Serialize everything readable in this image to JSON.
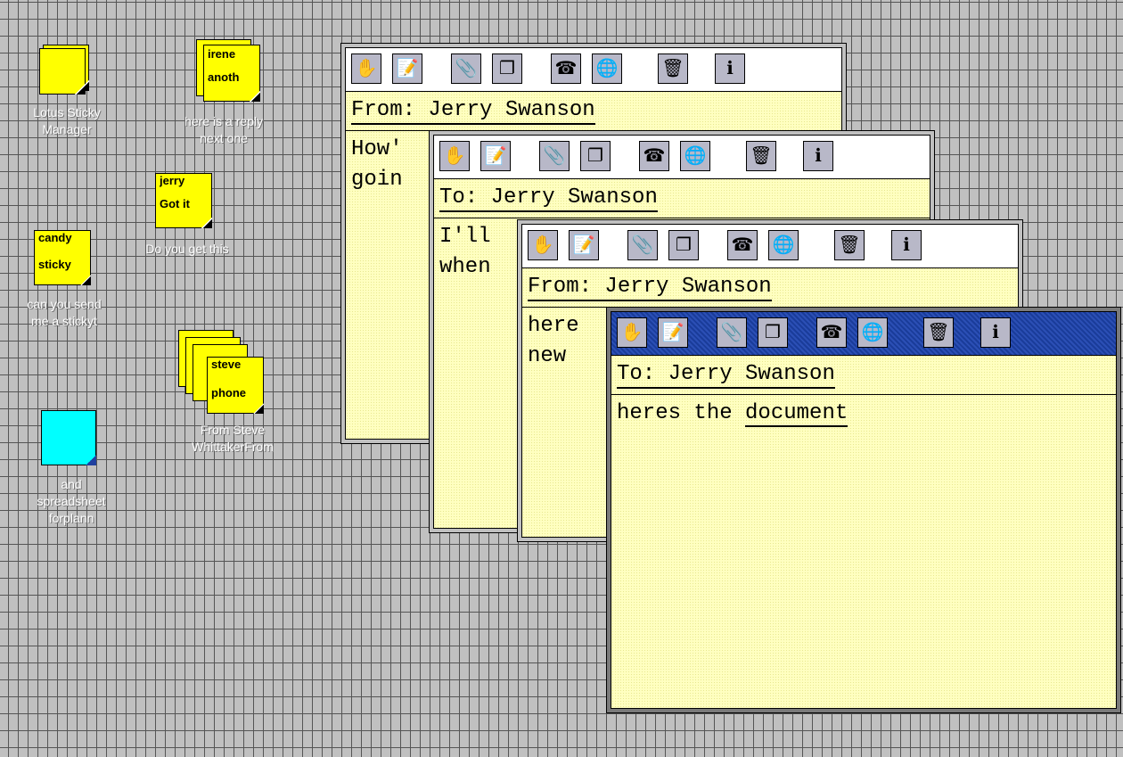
{
  "desktop": {
    "icons": [
      {
        "name": "lotus-sticky-manager",
        "label_line1": "Lotus Sticky",
        "label_line2": "Manager"
      },
      {
        "name": "irene-note",
        "note_line1": "irene",
        "note_line2": "anoth",
        "label_line1": "here is a reply",
        "label_line2": "next one"
      },
      {
        "name": "jerry-note",
        "note_line1": "jerry",
        "note_line2": "Got it",
        "label_line1": "Do you get this",
        "label_line2": ""
      },
      {
        "name": "candy-note",
        "note_line1": "candy",
        "note_line2": "sticky",
        "label_line1": "can you send",
        "label_line2": "me a stickyt"
      },
      {
        "name": "steve-note",
        "note_line1": "steve",
        "note_line2": "phone",
        "label_line1": "From Steve",
        "label_line2": "WhittakerFrom"
      },
      {
        "name": "spreadsheet-note",
        "label_line1": "and",
        "label_line2": "spreadsheet",
        "label_line3": "forplann"
      }
    ]
  },
  "toolbar_icons": [
    "hand-icon",
    "notepad-icon",
    "paperclip-icon",
    "copy-icon",
    "phone-icon",
    "globe-icon",
    "trash-icon",
    "info-icon"
  ],
  "toolbar_glyphs": [
    "✋",
    "📝",
    "📎",
    "❐",
    "☎",
    "🌐",
    "🗑",
    "ℹ"
  ],
  "windows": [
    {
      "header": "From: Jerry Swanson",
      "line1": "How'",
      "line2": "goin"
    },
    {
      "header": "To: Jerry Swanson",
      "line1": "I'll",
      "line2": "when"
    },
    {
      "header": "From: Jerry Swanson",
      "line1": "here",
      "line2": "new"
    },
    {
      "header": "To: Jerry Swanson",
      "line1_a": "heres the ",
      "line1_b": "document"
    }
  ],
  "colors": {
    "desktop": "#c0c0c0",
    "note": "#ffff00",
    "note_body": "#ffffc0",
    "spreadsheet_note": "#00ffff",
    "active_bar": "#1a3c9a"
  }
}
